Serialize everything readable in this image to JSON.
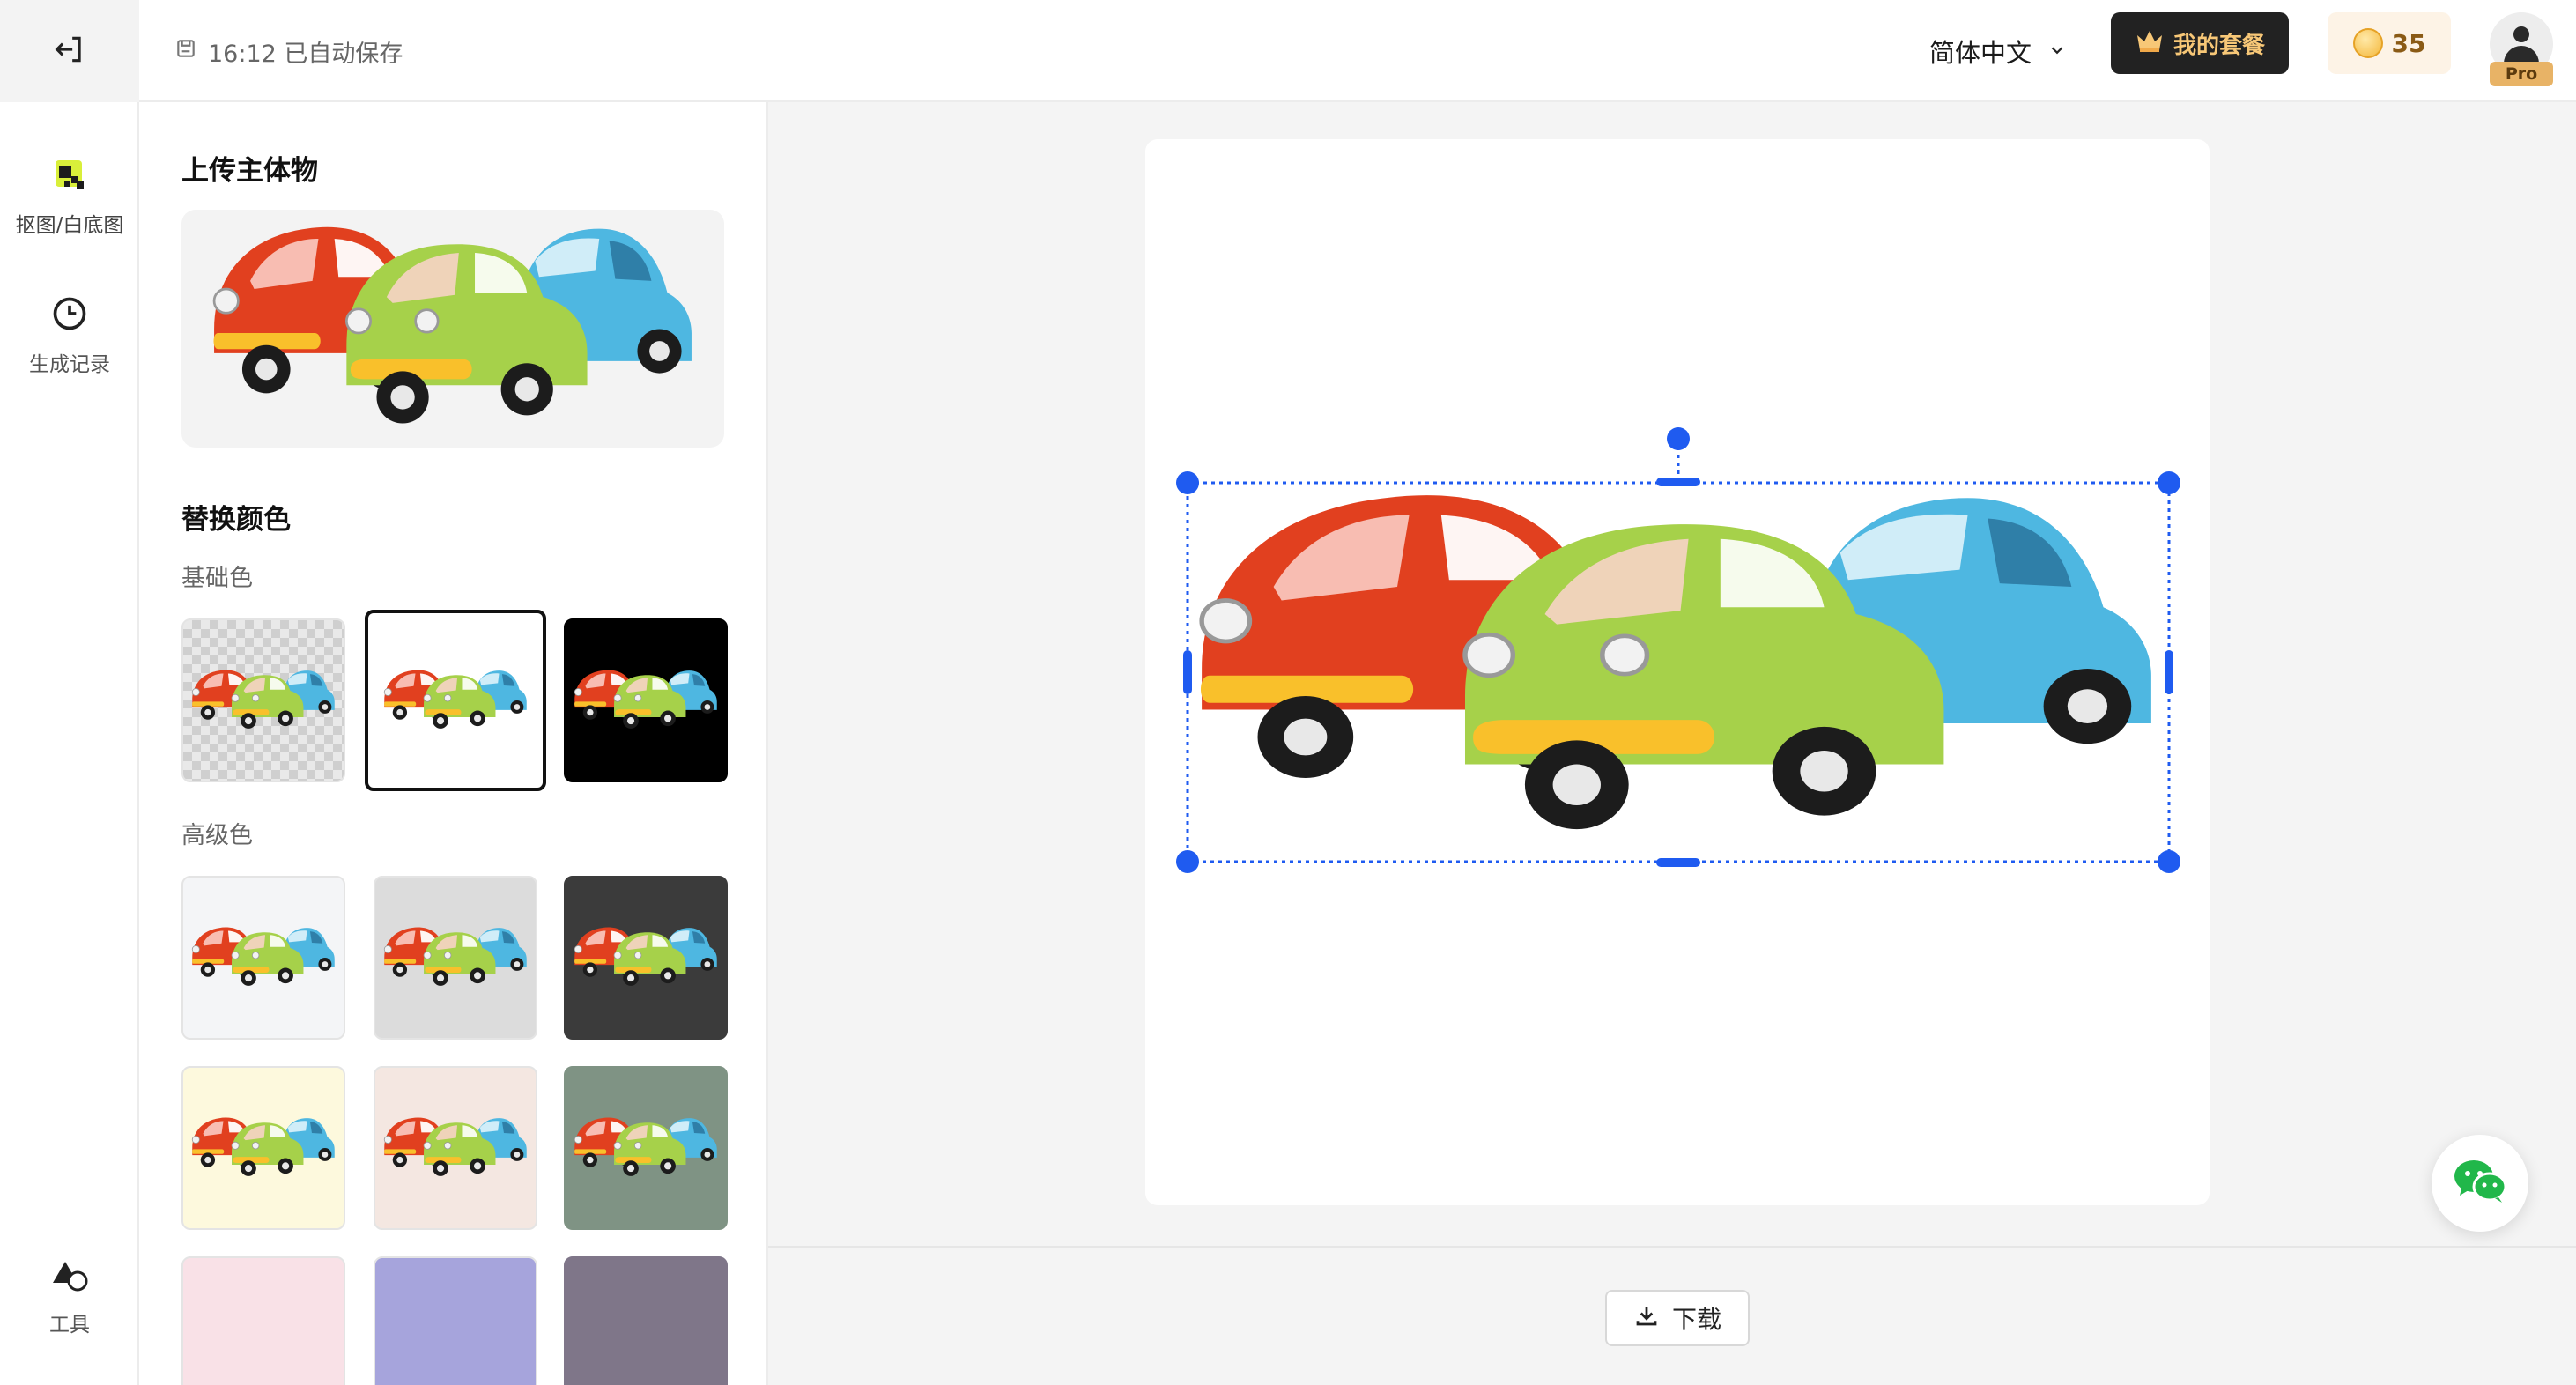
{
  "header": {
    "back_icon": "exit-icon",
    "save_status": "16:12 已自动保存",
    "language": "简体中文",
    "plan_button": "我的套餐",
    "credits": "35",
    "pro_badge": "Pro"
  },
  "nav": {
    "items": [
      {
        "label": "抠图/白底图",
        "icon": "cutout-icon"
      },
      {
        "label": "生成记录",
        "icon": "clock-icon"
      }
    ],
    "tools_label": "工具"
  },
  "panel": {
    "upload_title": "上传主体物",
    "replace_title": "替换颜色",
    "basic_label": "基础色",
    "advanced_label": "高级色"
  },
  "swatches": {
    "basic": [
      "transparent",
      "#ffffff",
      "#000000"
    ],
    "advanced": [
      "#f4f5f7",
      "#dcdcdc",
      "#3b3b3b",
      "#fdf9dd",
      "#f4e7e1",
      "#7f9384",
      "#f9e1e7",
      "#a6a4dc",
      "#7f7689"
    ]
  },
  "footer": {
    "download": "下载"
  },
  "colors": {
    "accent": "#1f5bf0",
    "car_red": "#e1401f",
    "car_green": "#a6d14a",
    "car_blue": "#4eb7e1",
    "bumper": "#f9c02b"
  }
}
